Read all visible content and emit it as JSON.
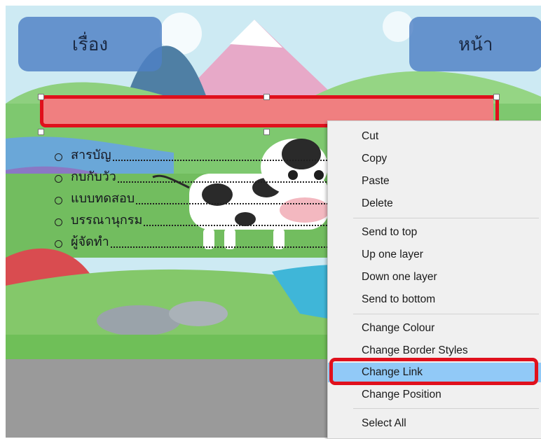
{
  "nav": {
    "left_button": "เรื่อง",
    "right_button": "หน้า"
  },
  "contents": [
    "สารบัญ",
    "กบกับวัว",
    "แบบทดสอบ",
    "บรรณานุกรม",
    "ผู้จัดทำ"
  ],
  "context_menu": {
    "items": [
      "Cut",
      "Copy",
      "Paste",
      "Delete",
      "Send to top",
      "Up one layer",
      "Down one layer",
      "Send to bottom",
      "Change Colour",
      "Change Border Styles",
      "Change Link",
      "Change Position",
      "Select All"
    ],
    "highlighted_item": "Change Link"
  },
  "colors": {
    "nav_button": "#4e80c4",
    "selected_bar": "#f07f80",
    "highlight_frame": "#e0101c",
    "menu_hover": "#91c9f7",
    "menu_background": "#f0f0f0"
  }
}
